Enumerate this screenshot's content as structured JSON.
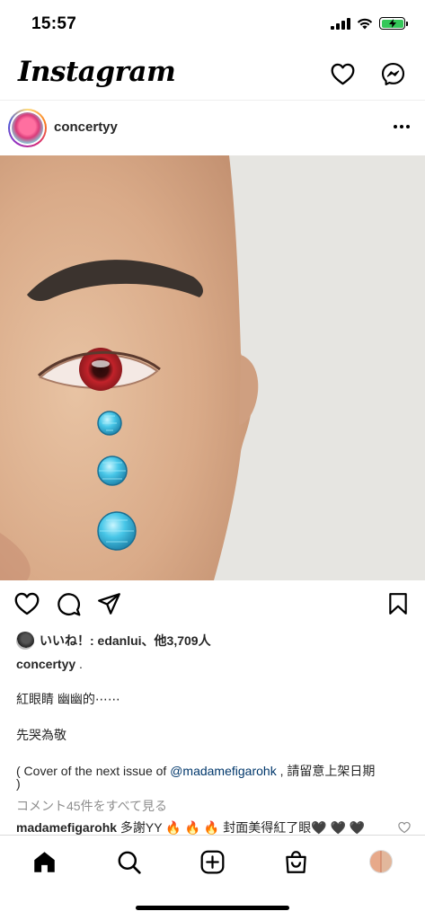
{
  "status_bar": {
    "time": "15:57"
  },
  "header": {
    "logo_text": "Instagram",
    "icons": [
      "heart-icon",
      "messenger-icon"
    ]
  },
  "post": {
    "username": "concertyy",
    "more_icon": "more-horizontal-icon",
    "image_alt": "Close-up of bald man's face with red eye and three blue gem teardrops",
    "actions": [
      "like-icon",
      "comment-icon",
      "share-icon",
      "save-icon"
    ],
    "likes_text": "いいね！: edanlui、他3,709人",
    "caption_username": "concertyy",
    "caption_suffix": " .",
    "caption_line_1": "紅眼睛 幽幽的⋯⋯",
    "caption_line_2": "先哭為敬",
    "caption_line_3_pre": "( Cover of the next issue of ",
    "caption_line_3_link": "@madamefigarohk",
    "caption_line_3_post": " ,  請留意上架日期",
    "caption_line_4": ")",
    "view_comments": "コメント45件をすべて見る",
    "comment_username": "madamefigarohk",
    "comment_text": " 多謝YY 🔥 🔥 🔥 封面美得紅了眼🖤 🖤 🖤"
  },
  "tab_bar": {
    "tabs": [
      "home-icon",
      "search-icon",
      "new-post-icon",
      "shop-icon",
      "profile-avatar"
    ]
  },
  "colors": {
    "text": "#262626",
    "muted": "#8e8e8e",
    "link": "#00376b",
    "battery": "#34c759"
  }
}
